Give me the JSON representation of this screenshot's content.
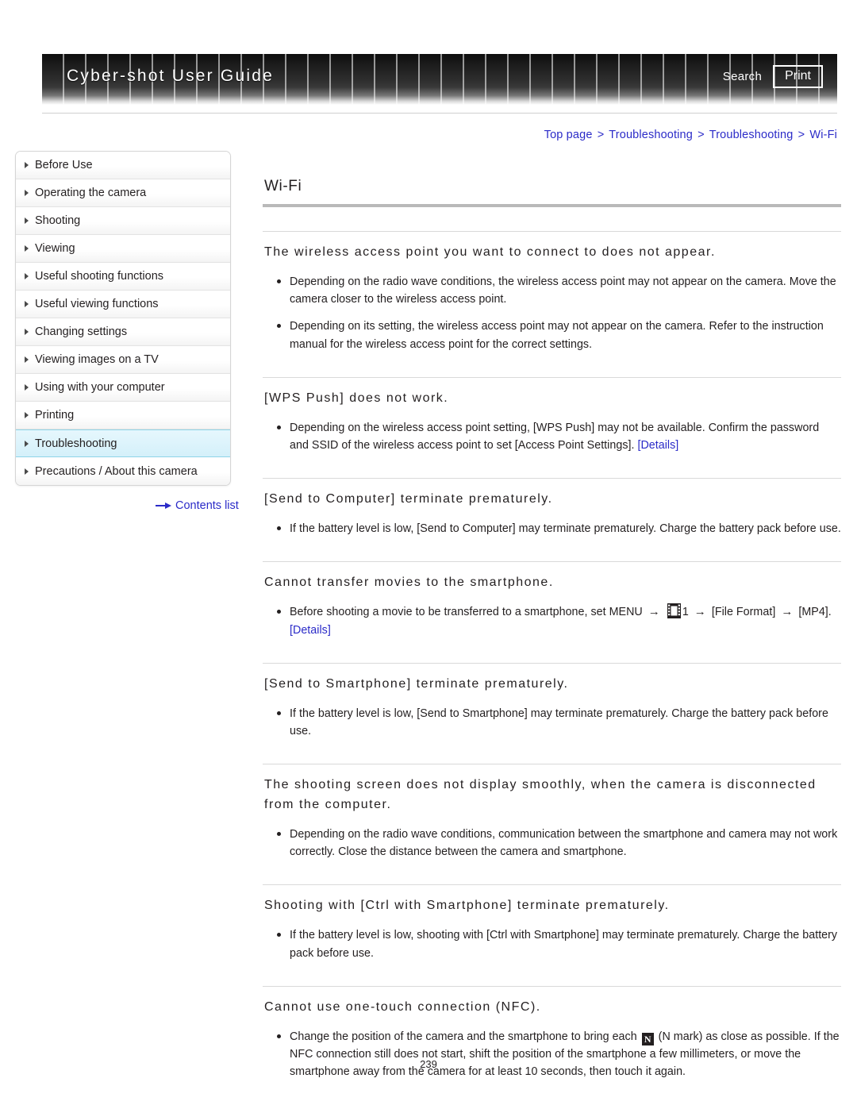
{
  "header": {
    "title": "Cyber-shot User Guide",
    "search_label": "Search",
    "print_label": "Print"
  },
  "breadcrumb": {
    "items": [
      "Top page",
      "Troubleshooting",
      "Troubleshooting",
      "Wi-Fi"
    ],
    "separator": ">"
  },
  "sidebar": {
    "items": [
      {
        "label": "Before Use",
        "selected": false
      },
      {
        "label": "Operating the camera",
        "selected": false
      },
      {
        "label": "Shooting",
        "selected": false
      },
      {
        "label": "Viewing",
        "selected": false
      },
      {
        "label": "Useful shooting functions",
        "selected": false
      },
      {
        "label": "Useful viewing functions",
        "selected": false
      },
      {
        "label": "Changing settings",
        "selected": false
      },
      {
        "label": "Viewing images on a TV",
        "selected": false
      },
      {
        "label": "Using with your computer",
        "selected": false
      },
      {
        "label": "Printing",
        "selected": false
      },
      {
        "label": "Troubleshooting",
        "selected": true
      },
      {
        "label": "Precautions / About this camera",
        "selected": false
      }
    ],
    "contents_link": "Contents list"
  },
  "main": {
    "page_title": "Wi-Fi",
    "sections": [
      {
        "heading": "The wireless access point you want to connect to does not appear.",
        "bullets": [
          "Depending on the radio wave conditions, the wireless access point may not appear on the camera. Move the camera closer to the wireless access point.",
          "Depending on its setting, the wireless access point may not appear on the camera. Refer to the instruction manual for the wireless access point for the correct settings."
        ]
      },
      {
        "heading": "[WPS Push] does not work.",
        "bullets": [
          "Depending on the wireless access point setting, [WPS Push] may not be available. Confirm the password and SSID of the wireless access point to set [Access Point Settings]."
        ],
        "bullet_links": [
          "[Details]"
        ]
      },
      {
        "heading": "[Send to Computer] terminate prematurely.",
        "bullets": [
          "If the battery level is low, [Send to Computer] may terminate prematurely. Charge the battery pack before use."
        ]
      },
      {
        "heading": "Cannot transfer movies to the smartphone.",
        "bullets_rich": {
          "part1": "Before shooting a movie to be transferred to a smartphone, set MENU",
          "arrow1": "→",
          "icon1": "movie-mode-icon",
          "part2": "1",
          "arrow2": "→",
          "part3": "[File Format]",
          "arrow3": "→",
          "part4": "[MP4].",
          "link": "[Details]"
        }
      },
      {
        "heading": "[Send to Smartphone] terminate prematurely.",
        "bullets": [
          "If the battery level is low, [Send to Smartphone] may terminate prematurely. Charge the battery pack before use."
        ]
      },
      {
        "heading": "The shooting screen does not display smoothly, when the camera is disconnected from the computer.",
        "bullets": [
          "Depending on the radio wave conditions, communication between the smartphone and camera may not work correctly. Close the distance between the camera and smartphone."
        ]
      },
      {
        "heading": "Shooting with [Ctrl with Smartphone] terminate prematurely.",
        "bullets": [
          "If the battery level is low, shooting with [Ctrl with Smartphone] may terminate prematurely. Charge the battery pack before use."
        ]
      },
      {
        "heading": "Cannot use one-touch connection (NFC).",
        "bullets_nfc": {
          "part1": "Change the position of the camera and the smartphone to bring each",
          "icon": "N",
          "part2": "(N mark) as close as possible. If the NFC connection still does not start, shift the position of the smartphone a few millimeters, or move the smartphone away from the camera for at least 10 seconds, then touch it again."
        }
      }
    ]
  },
  "footer": {
    "page_number": "239"
  },
  "colors": {
    "link": "#2b2bc8",
    "selected_nav": "#d4f0fa",
    "text": "#231f20"
  }
}
